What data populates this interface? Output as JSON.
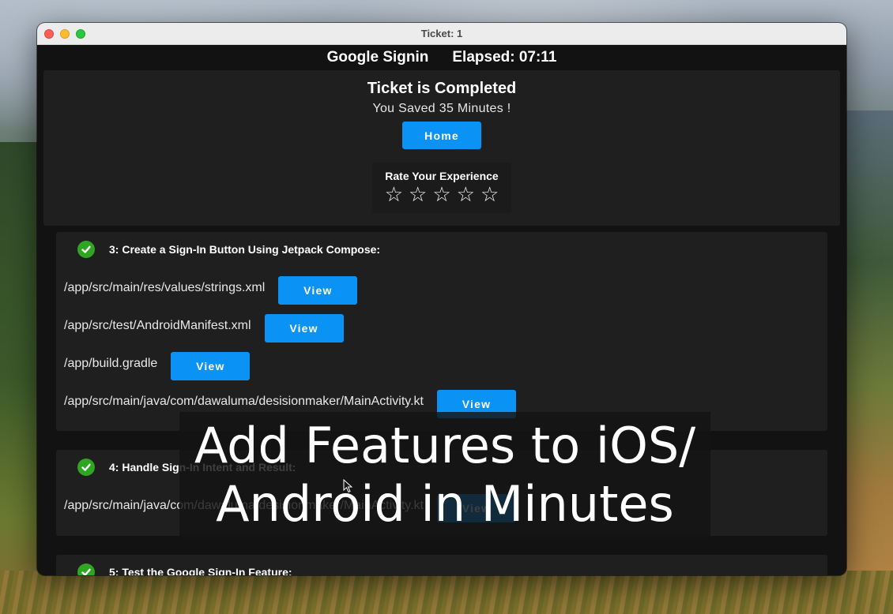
{
  "window": {
    "title": "Ticket: 1"
  },
  "header": {
    "app_name": "Google Signin",
    "elapsed": "Elapsed: 07:11"
  },
  "completion": {
    "title": "Ticket is Completed",
    "subtitle": "You Saved 35 Minutes !",
    "home_label": "Home",
    "rate_label": "Rate Your Experience",
    "stars_total": 5,
    "stars_filled": 0
  },
  "steps": [
    {
      "title": "3: Create a Sign-In Button Using Jetpack Compose:",
      "files": [
        {
          "path": "/app/src/main/res/values/strings.xml",
          "action": "View"
        },
        {
          "path": "/app/src/test/AndroidManifest.xml",
          "action": "View"
        },
        {
          "path": "/app/build.gradle",
          "action": "View"
        },
        {
          "path": "/app/src/main/java/com/dawaluma/desisionmaker/MainActivity.kt",
          "action": "View"
        }
      ]
    },
    {
      "title": "4: Handle Sign-In Intent and Result:",
      "files": [
        {
          "path": "/app/src/main/java/com/dawaluma/desisionmaker/MainActivity.kt",
          "action": "View"
        }
      ]
    },
    {
      "title": "5: Test the Google Sign-In Feature:",
      "files": []
    }
  ],
  "overlay": {
    "line1": "Add Features to iOS/",
    "line2": "Android in Minutes"
  },
  "colors": {
    "accent": "#0a93f5",
    "check": "#2fa521",
    "panel": "#1f1f1f",
    "background": "#121212"
  }
}
